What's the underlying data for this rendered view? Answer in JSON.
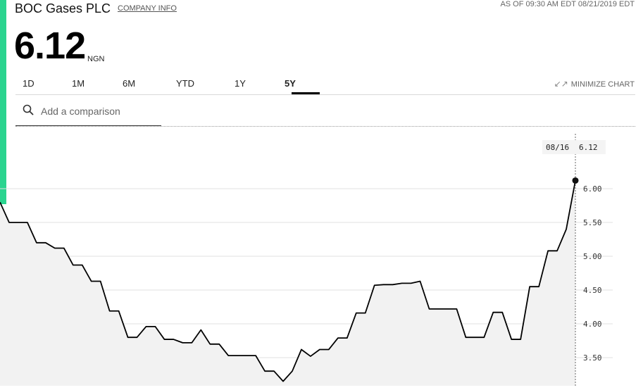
{
  "header": {
    "title": "BOC Gases PLC",
    "company_info_label": "COMPANY INFO",
    "as_of": "AS OF 09:30 AM EDT 08/21/2019 EDT",
    "price": "6.12",
    "currency": "NGN"
  },
  "tabs": [
    {
      "label": "1D"
    },
    {
      "label": "1M"
    },
    {
      "label": "6M"
    },
    {
      "label": "YTD"
    },
    {
      "label": "1Y"
    },
    {
      "label": "5Y"
    }
  ],
  "active_tab": "5Y",
  "minimize_label": "MINIMIZE CHART",
  "comparison": {
    "placeholder": "Add a comparison"
  },
  "colors": {
    "accent": "#2bd48f",
    "line": "#000000",
    "area": "#f2f2f2",
    "grid": "#e0e0e0"
  },
  "tooltip": {
    "date": "08/16",
    "value": "6.12"
  },
  "chart_data": {
    "type": "area",
    "ylim": [
      3.2,
      6.6
    ],
    "yticks": [
      "6.00",
      "5.50",
      "5.00",
      "4.50",
      "4.00",
      "3.50"
    ],
    "grid": true,
    "series": [
      {
        "values": [
          5.8,
          5.5,
          5.5,
          5.5,
          5.2,
          5.2,
          5.12,
          5.12,
          4.87,
          4.87,
          4.63,
          4.63,
          4.19,
          4.19,
          3.8,
          3.8,
          3.96,
          3.96,
          3.77,
          3.77,
          3.72,
          3.72,
          3.91,
          3.7,
          3.7,
          3.53,
          3.53,
          3.53,
          3.53,
          3.3,
          3.3,
          3.15,
          3.3,
          3.62,
          3.52,
          3.62,
          3.62,
          3.79,
          3.79,
          4.16,
          4.16,
          4.57,
          4.58,
          4.58,
          4.6,
          4.6,
          4.63,
          4.22,
          4.22,
          4.22,
          4.22,
          3.8,
          3.8,
          3.8,
          4.17,
          4.17,
          3.77,
          3.77,
          4.55,
          4.55,
          5.08,
          5.08,
          5.4,
          6.12
        ]
      }
    ]
  }
}
